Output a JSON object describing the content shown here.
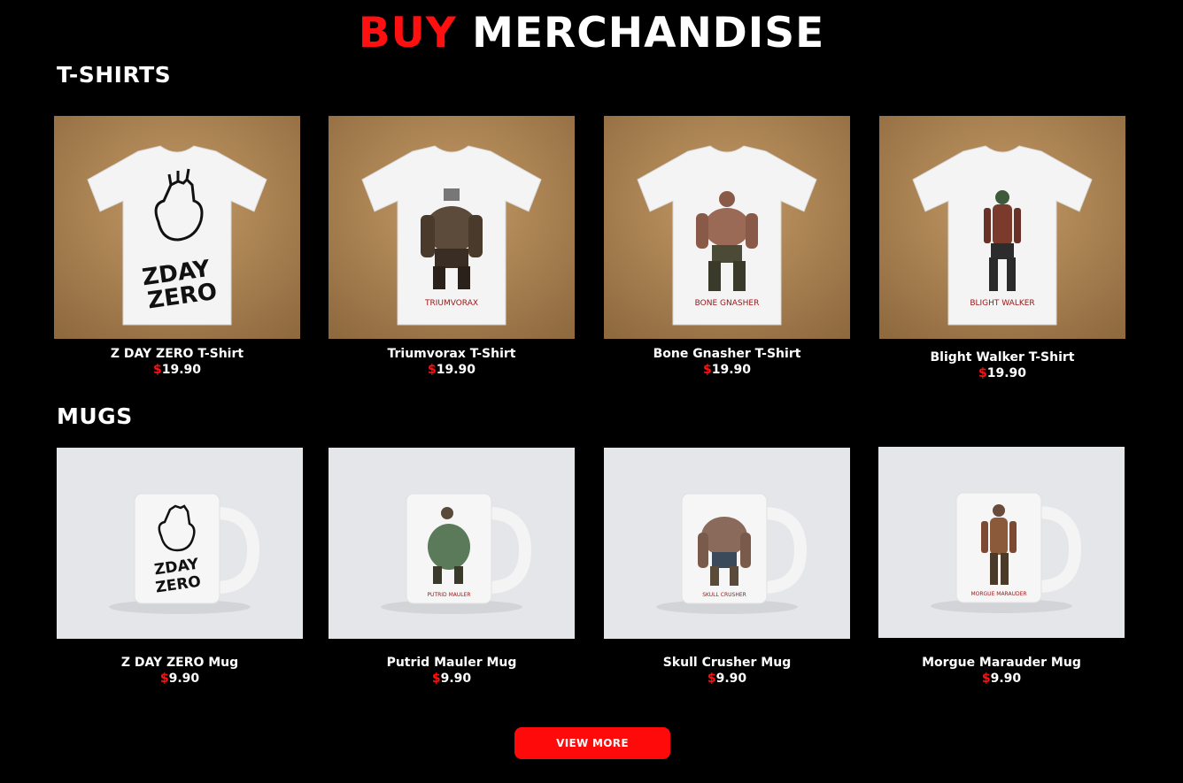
{
  "page": {
    "title_accent": "BUY",
    "title_rest": "MERCHANDISE"
  },
  "sections": {
    "tshirts": {
      "title": "T-SHIRTS",
      "items": [
        {
          "name": "Z DAY ZERO T-Shirt",
          "currency": "$",
          "price": "19.90",
          "print_text": "Z DAY ZERO",
          "icon": "zombie-hand-logo"
        },
        {
          "name": "Triumvorax T-Shirt",
          "currency": "$",
          "price": "19.90",
          "print_text": "TRIUMVORAX",
          "icon": "zombie-figure"
        },
        {
          "name": "Bone Gnasher T-Shirt",
          "currency": "$",
          "price": "19.90",
          "print_text": "BONE GNASHER",
          "icon": "zombie-figure"
        },
        {
          "name": "Blight Walker T-Shirt",
          "currency": "$",
          "price": "19.90",
          "print_text": "BLIGHT WALKER",
          "icon": "zombie-figure"
        }
      ]
    },
    "mugs": {
      "title": "MUGS",
      "items": [
        {
          "name": "Z DAY ZERO Mug",
          "currency": "$",
          "price": "9.90",
          "print_text": "Z DAY ZERO",
          "icon": "zombie-hand-logo"
        },
        {
          "name": "Putrid Mauler Mug",
          "currency": "$",
          "price": "9.90",
          "print_text": "PUTRID MAULER",
          "icon": "zombie-figure"
        },
        {
          "name": "Skull Crusher Mug",
          "currency": "$",
          "price": "9.90",
          "print_text": "SKULL CRUSHER",
          "icon": "zombie-figure"
        },
        {
          "name": "Morgue Marauder Mug",
          "currency": "$",
          "price": "9.90",
          "print_text": "MORGUE MARAUDER",
          "icon": "zombie-figure"
        }
      ]
    }
  },
  "actions": {
    "view_more_label": "VIEW MORE"
  },
  "colors": {
    "accent": "#ff1010",
    "background": "#000000",
    "tshirt_backdrop": "#b88a55",
    "mug_backdrop": "#e4e6ea",
    "print_text": "#9b1414"
  }
}
